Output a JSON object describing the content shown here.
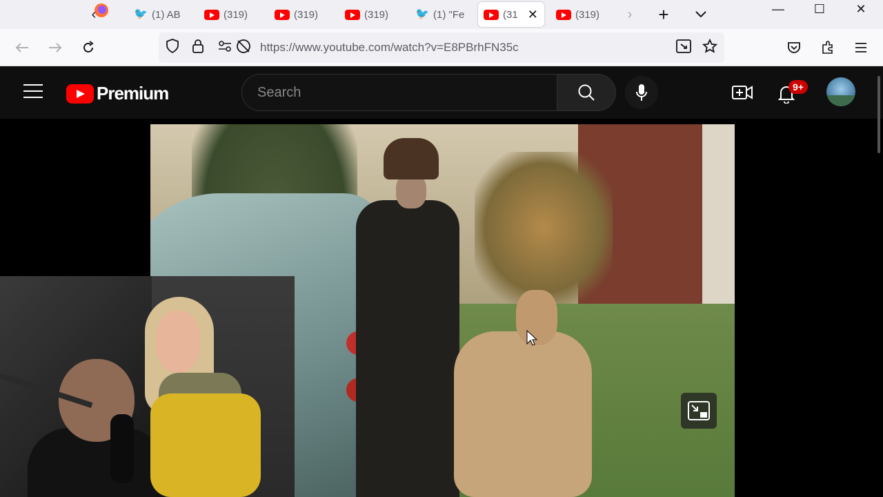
{
  "browser": {
    "tabs": [
      {
        "icon": "twitter-icon",
        "label": "(1) AB"
      },
      {
        "icon": "youtube-icon",
        "label": "(319)"
      },
      {
        "icon": "youtube-icon",
        "label": "(319)"
      },
      {
        "icon": "youtube-icon",
        "label": "(319)"
      },
      {
        "icon": "twitter-icon",
        "label": "(1) \"Fe"
      },
      {
        "icon": "youtube-icon",
        "label": "(31",
        "active": true
      },
      {
        "icon": "youtube-icon",
        "label": "(319)"
      }
    ],
    "url": "https://www.youtube.com/watch?v=E8PBrhFN35c"
  },
  "youtube": {
    "logo_text": "Premium",
    "search_placeholder": "Search",
    "notification_count": "9+"
  },
  "colors": {
    "accent": "#ff0000",
    "header_bg": "#0f0f0f",
    "badge": "#cc0000"
  }
}
